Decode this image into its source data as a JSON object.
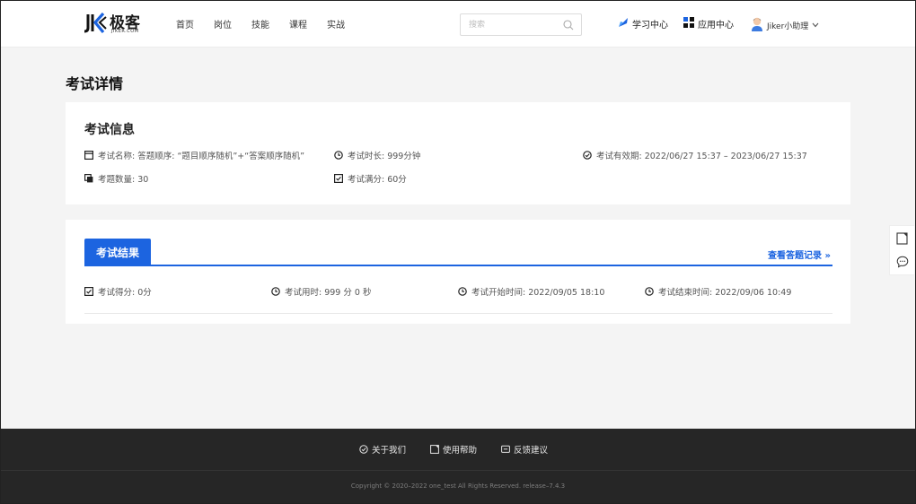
{
  "header": {
    "logo_text": "极客",
    "logo_sub": "JIKER.COM",
    "nav": [
      "首页",
      "岗位",
      "技能",
      "课程",
      "实战"
    ],
    "search_placeholder": "搜索",
    "learn_center": "学习中心",
    "app_center": "应用中心",
    "user_name": "Jiker小助理"
  },
  "page_title": "考试详情",
  "exam_info": {
    "title": "考试信息",
    "name": "考试名称: 答题顺序: “题目顺序随机”+“答案顺序随机”",
    "duration": "考试时长: 999分钟",
    "validity": "考试有效期: 2022/06/27 15:37 – 2023/06/27 15:37",
    "question_count": "考题数量: 30",
    "full_score": "考试满分: 60分"
  },
  "exam_result": {
    "tab": "考试结果",
    "view_record": "查看答题记录 »",
    "score": "考试得分: 0分",
    "time_used": "考试用时: 999 分 0 秒",
    "start_time": "考试开始时间: 2022/09/05 18:10",
    "end_time": "考试结束时间: 2022/09/06 10:49"
  },
  "footer": {
    "about": "关于我们",
    "help": "使用帮助",
    "feedback": "反馈建议",
    "copyright": "Copyright © 2020–2022 one_test All Rights Reserved. release–7.4.3"
  },
  "colors": {
    "accent": "#1c64e0",
    "footer_bg": "#262626",
    "page_bg": "#f4f4f4"
  },
  "icons": [
    "logo-mark-icon",
    "search-icon",
    "learn-center-icon",
    "app-grid-icon",
    "avatar",
    "chevron-down-icon",
    "calendar-icon",
    "clock-icon",
    "check-circle-icon",
    "copy-icon",
    "check-square-icon",
    "note-icon",
    "chat-icon",
    "feedback-icon"
  ]
}
